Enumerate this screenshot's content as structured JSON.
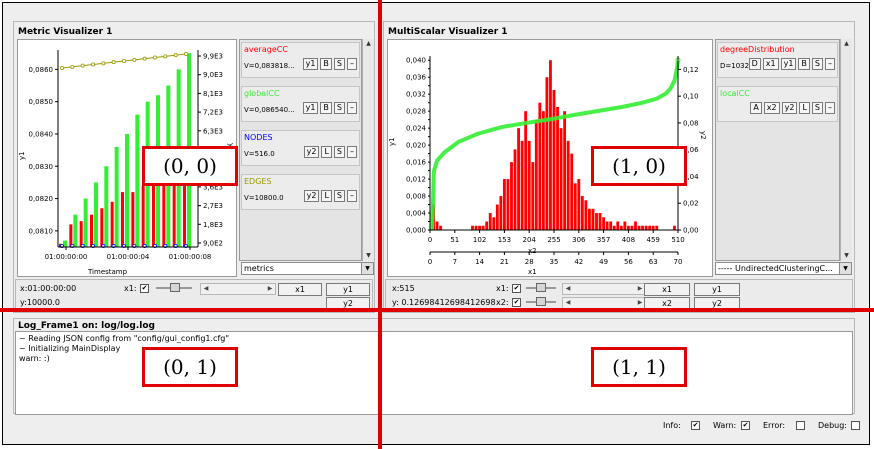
{
  "metric_panel": {
    "title": "Metric Visualizer 1",
    "ylabel": "y1",
    "y2label": "y2",
    "xlabel": "Timestamp",
    "legend": [
      {
        "name": "averageCC",
        "color": "#ff0000",
        "value": "V=0,083818...",
        "buttons": [
          "y1",
          "B",
          "S",
          "–"
        ]
      },
      {
        "name": "globalCC",
        "color": "#33ee33",
        "value": "V=0,086540...",
        "buttons": [
          "y1",
          "B",
          "S",
          "–"
        ]
      },
      {
        "name": "NODES",
        "color": "#0000ff",
        "value": "V=516.0",
        "buttons": [
          "y2",
          "L",
          "S",
          "–"
        ]
      },
      {
        "name": "EDGES",
        "color": "#999900",
        "value": "V=10800.0",
        "buttons": [
          "y2",
          "L",
          "S",
          "–"
        ]
      }
    ],
    "combo": "metrics",
    "controls": {
      "x": "x:01:00:00:00",
      "y": "y:10000.0",
      "x1_label": "x1:",
      "x1_checked": true,
      "buttons": {
        "x1": "x1",
        "y1": "y1",
        "y2": "y2"
      }
    },
    "chart_data": {
      "type": "bar",
      "x_ticks": [
        "01:00:00:00",
        "01:00:00:04",
        "01:00:00:08"
      ],
      "y_ticks": [
        "0,0860",
        "0,0850",
        "0,0840",
        "0,0830",
        "0,0820",
        "0,0810"
      ],
      "y_range": [
        0.0805,
        0.0866
      ],
      "y2_ticks": [
        "9,9E3",
        "9,0E3",
        "8,1E3",
        "7,2E3",
        "6,3E3",
        "5,4E3",
        "4,5E3",
        "3,6E3",
        "2,7E3",
        "1,8E3",
        "9,0E2"
      ],
      "series": [
        {
          "name": "averageCC",
          "color": "#ff0000",
          "values": [
            0.0806,
            0.0812,
            0.0813,
            0.0815,
            0.0817,
            0.0819,
            0.0822,
            0.0822,
            0.0824,
            0.0827,
            0.0829,
            0.0832,
            0.0834
          ]
        },
        {
          "name": "globalCC",
          "color": "#33ee33",
          "values": [
            0.0807,
            0.0815,
            0.082,
            0.0825,
            0.083,
            0.0836,
            0.084,
            0.0846,
            0.085,
            0.0852,
            0.0855,
            0.086,
            0.0865
          ]
        },
        {
          "name": "EDGES",
          "color": "#999900",
          "values": [
            10200,
            10250,
            10300,
            10350,
            10400,
            10450,
            10500,
            10550,
            10600,
            10650,
            10700,
            10750,
            10800
          ]
        }
      ]
    }
  },
  "multiscalar_panel": {
    "title": "MultiScalar Visualizer 1",
    "ylabel": "y1",
    "y2label": "y2",
    "xlabel": "x1",
    "x2label": "x2",
    "legend": [
      {
        "name": "degreeDistribution",
        "color": "#ff0000",
        "value": "D=1032",
        "buttons": [
          "D",
          "x1",
          "y1",
          "B",
          "S",
          "–"
        ]
      },
      {
        "name": "localCC",
        "color": "#33ee33",
        "value": "",
        "buttons": [
          "A",
          "x2",
          "y2",
          "L",
          "S",
          "–"
        ]
      }
    ],
    "combo": "----- UndirectedClusteringC...",
    "controls": {
      "x": "x:515",
      "y": "y: 0.12698412698412698",
      "x1_label": "x1:",
      "x2_label": "x2:",
      "x1_checked": true,
      "x2_checked": true,
      "buttons": {
        "x1": "x1",
        "y1": "y1",
        "x2": "x2",
        "y2": "y2"
      }
    },
    "chart_data": {
      "type": "bar",
      "x_ticks": [
        "0",
        "7",
        "14",
        "21",
        "28",
        "35",
        "42",
        "49",
        "56",
        "63",
        "70"
      ],
      "x2_ticks": [
        "0",
        "51",
        "102",
        "153",
        "204",
        "255",
        "306",
        "357",
        "408",
        "459",
        "510"
      ],
      "y_ticks": [
        "0,040",
        "0,038",
        "0,036",
        "0,034",
        "0,032",
        "0,030",
        "0,028",
        "0,026",
        "0,024",
        "0,022",
        "0,020",
        "0,018",
        "0,016",
        "0,014",
        "0,012",
        "0,010",
        "0,008",
        "0,006",
        "0,004",
        "0,002",
        "0,000"
      ],
      "y2_ticks": [
        "0,12",
        "0,10",
        "0,08",
        "0,06",
        "0,04",
        "0,02",
        "0,00"
      ],
      "x_range": [
        0,
        70
      ],
      "y_range": [
        0,
        0.041
      ],
      "y2_range": [
        0,
        0.13
      ],
      "series": [
        {
          "name": "degreeDistribution",
          "color": "#ff0000",
          "x": [
            1,
            2,
            3,
            12,
            13,
            14,
            15,
            16,
            17,
            18,
            19,
            20,
            21,
            22,
            23,
            24,
            25,
            26,
            27,
            28,
            29,
            30,
            31,
            32,
            33,
            34,
            35,
            36,
            37,
            38,
            39,
            40,
            41,
            42,
            43,
            44,
            45,
            46,
            47,
            48,
            49,
            50,
            51,
            52,
            53,
            54,
            55,
            56,
            57,
            58,
            59,
            60,
            61,
            62,
            63,
            64,
            69
          ],
          "values": [
            0.006,
            0.002,
            0.001,
            0.001,
            0.001,
            0.001,
            0.001,
            0.002,
            0.004,
            0.003,
            0.006,
            0.008,
            0.012,
            0.012,
            0.016,
            0.019,
            0.024,
            0.021,
            0.028,
            0.021,
            0.016,
            0.026,
            0.03,
            0.028,
            0.036,
            0.04,
            0.033,
            0.029,
            0.024,
            0.028,
            0.021,
            0.018,
            0.011,
            0.012,
            0.008,
            0.007,
            0.005,
            0.005,
            0.004,
            0.004,
            0.003,
            0.002,
            0.002,
            0.001,
            0.002,
            0.001,
            0.002,
            0.001,
            0.001,
            0.002,
            0.001,
            0.001,
            0.001,
            0.001,
            0.001,
            0.001,
            0.001
          ]
        },
        {
          "name": "localCC",
          "color": "#33ee33",
          "x2_range": [
            0,
            515
          ],
          "points": [
            [
              0,
              0.001
            ],
            [
              4,
              0.001
            ],
            [
              6,
              0.018
            ],
            [
              8,
              0.044
            ],
            [
              15,
              0.052
            ],
            [
              30,
              0.058
            ],
            [
              60,
              0.066
            ],
            [
              100,
              0.072
            ],
            [
              150,
              0.077
            ],
            [
              200,
              0.08
            ],
            [
              255,
              0.083
            ],
            [
              300,
              0.086
            ],
            [
              350,
              0.089
            ],
            [
              400,
              0.092
            ],
            [
              440,
              0.095
            ],
            [
              470,
              0.098
            ],
            [
              490,
              0.102
            ],
            [
              500,
              0.106
            ],
            [
              508,
              0.112
            ],
            [
              513,
              0.121
            ],
            [
              515,
              0.127
            ]
          ]
        }
      ]
    }
  },
  "log": {
    "title": "Log_Frame1 on: log/log.log",
    "lines": [
      "~ Reading JSON config from \"config/gui_config1.cfg\"",
      "~ Initializing MainDisplay",
      "warn: :)"
    ],
    "filters": [
      {
        "label": "Info:",
        "checked": true
      },
      {
        "label": "Warn:",
        "checked": true
      },
      {
        "label": "Error:",
        "checked": false
      },
      {
        "label": "Debug:",
        "checked": false
      }
    ]
  },
  "overlay_labels": [
    "(0, 0)",
    "(1, 0)",
    "(0, 1)",
    "(1, 1)"
  ]
}
